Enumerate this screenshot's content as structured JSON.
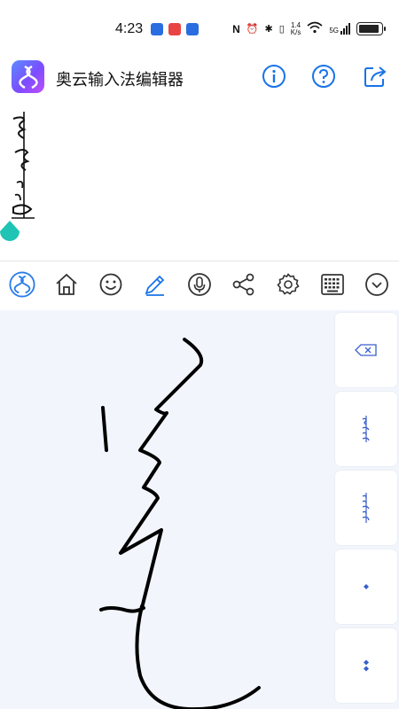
{
  "status_bar": {
    "time": "4:23",
    "speed_top": "1.4",
    "speed_bottom": "K/s",
    "network": "5G"
  },
  "app": {
    "title": "奥云输入法编辑器"
  },
  "header_icons": [
    "info-icon",
    "help-icon",
    "share-icon"
  ],
  "toolbar": {
    "icons": [
      "app-logo-icon",
      "home-icon",
      "emoji-icon",
      "pen-icon",
      "mic-icon",
      "share-icon",
      "settings-icon",
      "keyboard-icon",
      "collapse-icon"
    ]
  },
  "side_keys": {
    "icons": [
      "backspace-icon",
      "candidate-word-icon",
      "candidate-word-icon",
      "punctuation-icon",
      "punctuation-icon"
    ]
  },
  "colors": {
    "accent": "#1a73e8",
    "toolbar_icon": "#333333",
    "teal_cursor": "#1fc4b4",
    "keyboard_bg": "#f2f6fc"
  }
}
